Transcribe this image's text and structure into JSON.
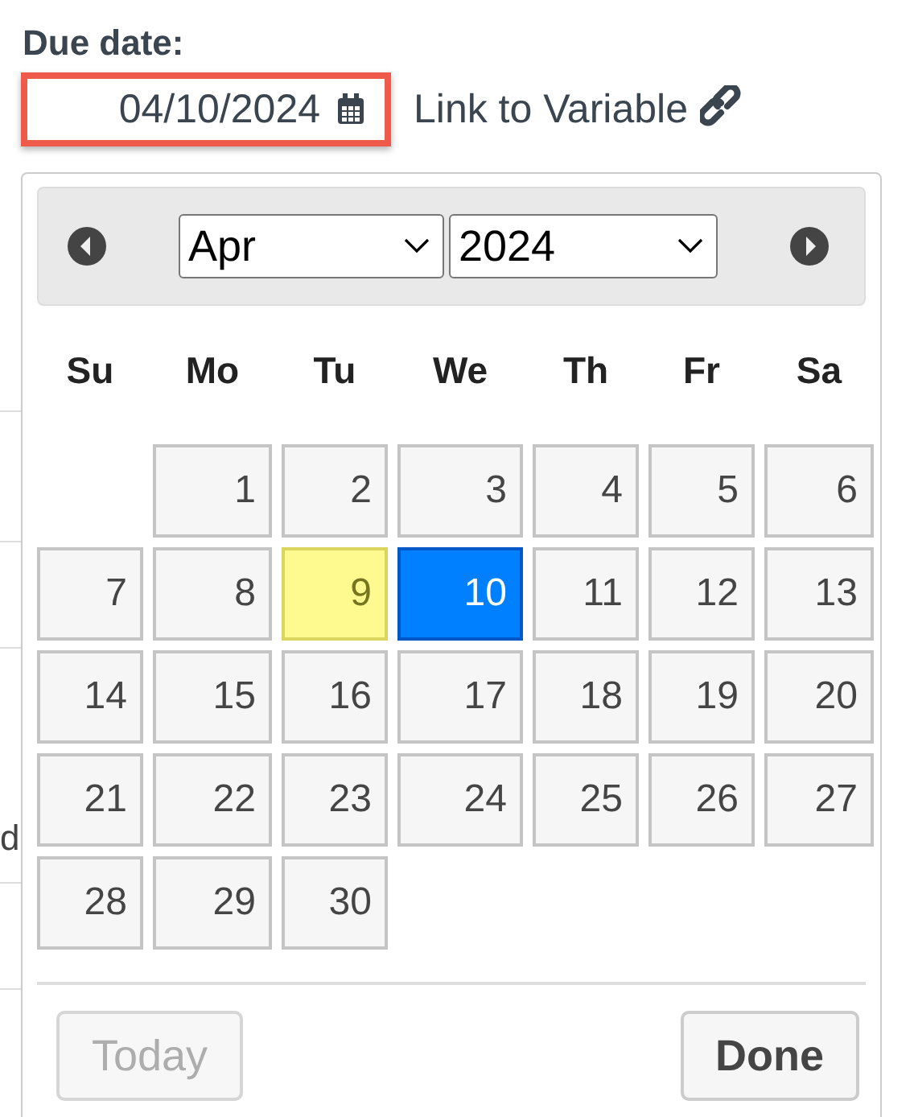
{
  "due_date": {
    "label": "Due date:",
    "value": "04/10/2024",
    "highlighted": true
  },
  "link": {
    "label": "Link to Variable"
  },
  "background_text": "d",
  "datepicker": {
    "month": "Apr",
    "year": "2024",
    "weekdays": [
      "Su",
      "Mo",
      "Tu",
      "We",
      "Th",
      "Fr",
      "Sa"
    ],
    "weeks": [
      [
        {
          "label": "1",
          "today": false,
          "selected": false
        },
        {
          "label": "2",
          "today": false,
          "selected": false
        },
        {
          "label": "3",
          "today": false,
          "selected": false
        },
        {
          "label": "4",
          "today": false,
          "selected": false
        },
        {
          "label": "5",
          "today": false,
          "selected": false
        },
        {
          "label": "6",
          "today": false,
          "selected": false
        }
      ],
      [
        {
          "label": "7",
          "today": false,
          "selected": false
        },
        {
          "label": "8",
          "today": false,
          "selected": false
        },
        {
          "label": "9",
          "today": true,
          "selected": false
        },
        {
          "label": "10",
          "today": false,
          "selected": true
        },
        {
          "label": "11",
          "today": false,
          "selected": false
        },
        {
          "label": "12",
          "today": false,
          "selected": false
        },
        {
          "label": "13",
          "today": false,
          "selected": false
        }
      ],
      [
        {
          "label": "14",
          "today": false,
          "selected": false
        },
        {
          "label": "15",
          "today": false,
          "selected": false
        },
        {
          "label": "16",
          "today": false,
          "selected": false
        },
        {
          "label": "17",
          "today": false,
          "selected": false
        },
        {
          "label": "18",
          "today": false,
          "selected": false
        },
        {
          "label": "19",
          "today": false,
          "selected": false
        },
        {
          "label": "20",
          "today": false,
          "selected": false
        }
      ],
      [
        {
          "label": "21",
          "today": false,
          "selected": false
        },
        {
          "label": "22",
          "today": false,
          "selected": false
        },
        {
          "label": "23",
          "today": false,
          "selected": false
        },
        {
          "label": "24",
          "today": false,
          "selected": false
        },
        {
          "label": "25",
          "today": false,
          "selected": false
        },
        {
          "label": "26",
          "today": false,
          "selected": false
        },
        {
          "label": "27",
          "today": false,
          "selected": false
        }
      ],
      [
        {
          "label": "28",
          "today": false,
          "selected": false
        },
        {
          "label": "29",
          "today": false,
          "selected": false
        },
        {
          "label": "30",
          "today": false,
          "selected": false
        }
      ]
    ],
    "buttons": [
      {
        "label": "Today",
        "disabled": true
      },
      {
        "label": "Done",
        "disabled": false
      }
    ]
  }
}
